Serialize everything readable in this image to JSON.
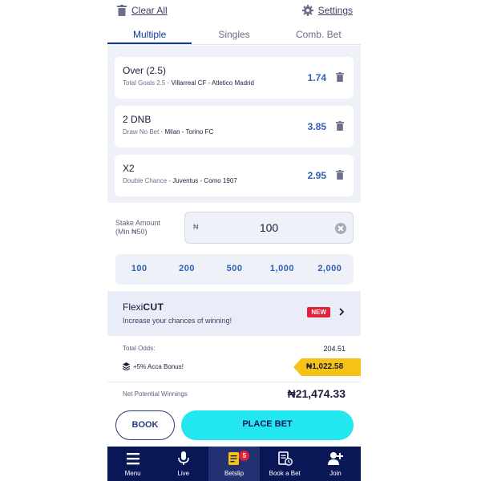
{
  "colors": {
    "accent": "#0d3b9e",
    "odds": "#2b5fb8",
    "cta": "#22e6f0",
    "nav_bg": "#0a1757",
    "bonus": "#f6c216",
    "badge": "#e41f3a"
  },
  "header": {
    "clear_all": "Clear All",
    "settings": "Settings"
  },
  "tabs": [
    "Multiple",
    "Singles",
    "Comb. Bet"
  ],
  "bets": [
    {
      "selection": "Over (2.5)",
      "market": "Total Goals 2.5 -",
      "match": "Villarreal CF - Atletico Madrid",
      "odds": "1.74"
    },
    {
      "selection": "2 DNB",
      "market": "Draw No Bet -",
      "match": "Milan - Torino FC",
      "odds": "3.85"
    },
    {
      "selection": "X2",
      "market": "Double Chance -",
      "match": "Juventus - Como 1907",
      "odds": "2.95"
    }
  ],
  "stake": {
    "label_line1": "Stake Amount",
    "label_line2": "(Min ₦50)",
    "currency": "₦",
    "value": "100",
    "quick_amounts": [
      "100",
      "200",
      "500",
      "1,000",
      "2,000"
    ]
  },
  "flexicut": {
    "brand_prefix": "Flexi",
    "brand_suffix": "CUT",
    "description": "Increase your chances of winning!",
    "badge": "NEW"
  },
  "totals": {
    "total_odds_label": "Total Odds:",
    "total_odds_value": "204.51",
    "bonus_label": "+5% Acca Bonus!",
    "bonus_value": "₦1,022.58",
    "potential_label": "Net Potential Winnings",
    "potential_value": "₦21,474.33"
  },
  "actions": {
    "book": "BOOK",
    "place_bet": "PLACE BET"
  },
  "nav": {
    "items": [
      {
        "label": "Menu",
        "icon": "menu-icon"
      },
      {
        "label": "Live",
        "icon": "microphone-icon"
      },
      {
        "label": "Betslip",
        "icon": "betslip-icon"
      },
      {
        "label": "Book a Bet",
        "icon": "book-bet-icon"
      },
      {
        "label": "Join",
        "icon": "add-user-icon"
      }
    ],
    "betslip_count": "5"
  }
}
